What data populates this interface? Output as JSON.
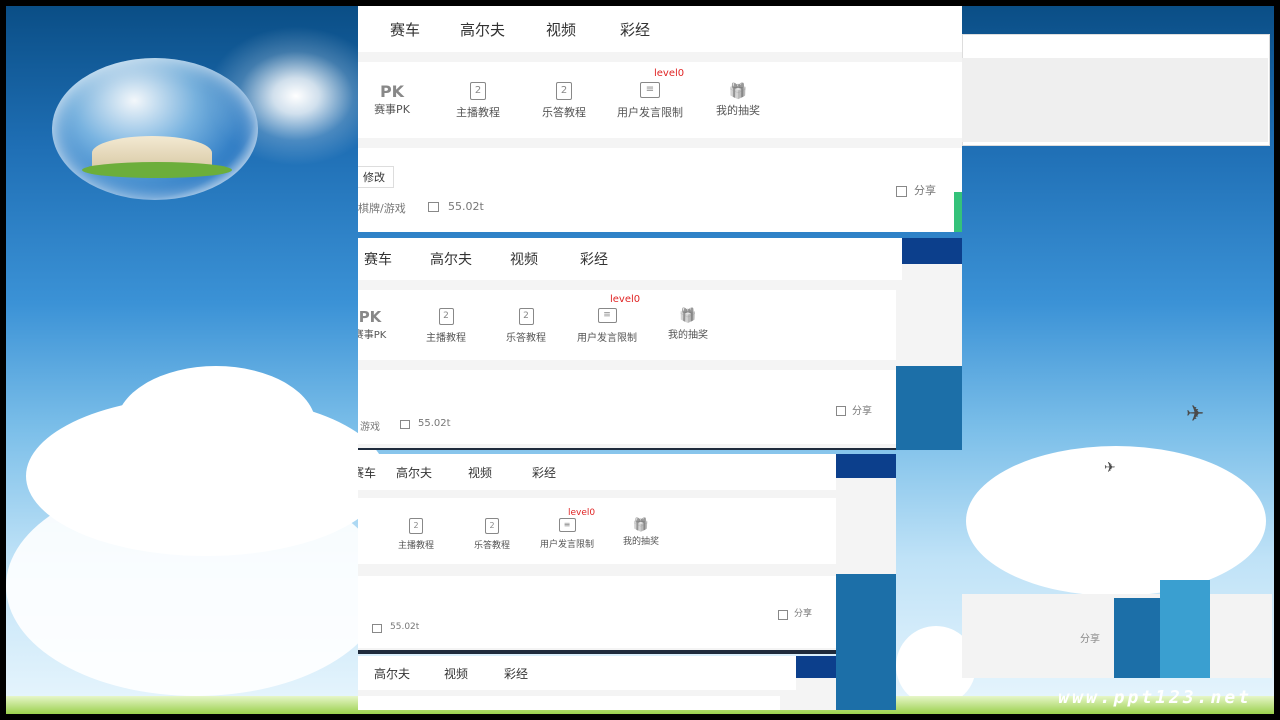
{
  "nav": [
    "赛车",
    "高尔夫",
    "视频",
    "彩经"
  ],
  "tools": [
    {
      "icon": "pk-icon",
      "glyph": "PK",
      "label": "赛事PK"
    },
    {
      "icon": "tutorial-icon",
      "glyph": "2",
      "label": "主播教程"
    },
    {
      "icon": "qa-icon",
      "glyph": "2",
      "label": "乐答教程"
    },
    {
      "icon": "restrict-icon",
      "glyph": "≡",
      "label": "用户发言限制"
    },
    {
      "icon": "gift-icon",
      "glyph": "🎁",
      "label": "我的抽奖"
    }
  ],
  "level_badge": "level0",
  "modify": "修改",
  "category": "棋牌/游戏",
  "category_short": "游戏",
  "stat": "55.02t",
  "share": "分享",
  "watermark": "www.ppt123.net"
}
